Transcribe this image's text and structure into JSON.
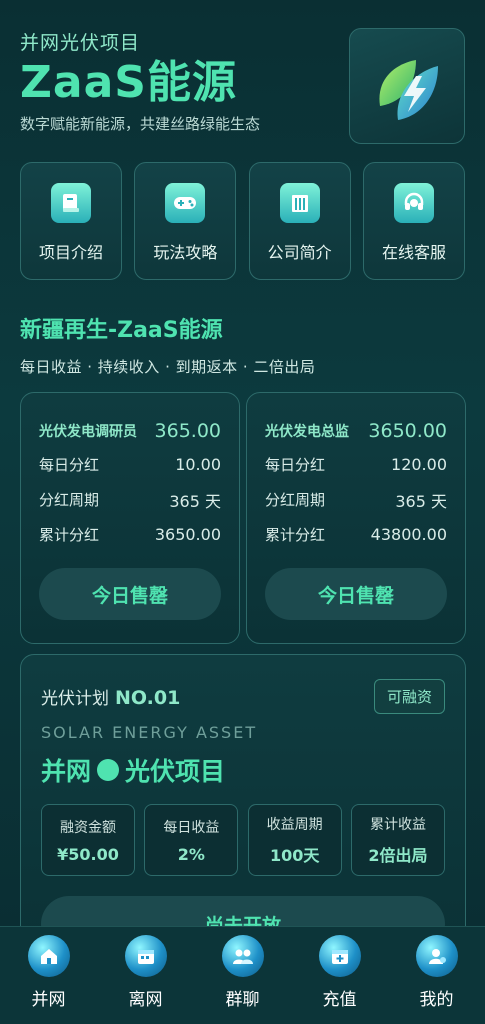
{
  "header": {
    "subtitle": "并网光伏项目",
    "brand": "ZaaS能源",
    "slogan": "数字赋能新能源，共建丝路绿能生态",
    "logo_icon": "leaf-lightning-logo"
  },
  "quick_nav": [
    {
      "label": "项目介绍",
      "icon": "book-icon"
    },
    {
      "label": "玩法攻略",
      "icon": "gamepad-icon"
    },
    {
      "label": "公司简介",
      "icon": "building-icon"
    },
    {
      "label": "在线客服",
      "icon": "headset-icon"
    }
  ],
  "section": {
    "title": "新疆再生-ZaaS能源",
    "tags": "每日收益 · 持续收入 · 到期返本 · 二倍出局"
  },
  "products": [
    {
      "name": "光伏发电调研员",
      "price": "365.00",
      "rows": [
        {
          "label": "每日分红",
          "value": "10.00"
        },
        {
          "label": "分红周期",
          "value": "365 天"
        },
        {
          "label": "累计分红",
          "value": "3650.00"
        }
      ],
      "button": "今日售罄"
    },
    {
      "name": "光伏发电总监",
      "price": "3650.00",
      "rows": [
        {
          "label": "每日分红",
          "value": "120.00"
        },
        {
          "label": "分红周期",
          "value": "365 天"
        },
        {
          "label": "累计分红",
          "value": "43800.00"
        }
      ],
      "button": "今日售罄"
    }
  ],
  "plan": {
    "prefix": "光伏计划",
    "number": "NO.01",
    "badge": "可融资",
    "english": "SOLAR ENERGY ASSET",
    "title_left": "并网",
    "title_right": "光伏项目",
    "stats": [
      {
        "label": "融资金额",
        "value": "¥50.00"
      },
      {
        "label": "每日收益",
        "value": "2%"
      },
      {
        "label": "收益周期",
        "value": "100天"
      },
      {
        "label": "累计收益",
        "value": "2倍出局"
      }
    ],
    "button": "尚未开放"
  },
  "tabbar": [
    {
      "label": "并网",
      "icon": "home-icon"
    },
    {
      "label": "离网",
      "icon": "calendar-icon"
    },
    {
      "label": "群聊",
      "icon": "group-chat-icon"
    },
    {
      "label": "充值",
      "icon": "recharge-icon"
    },
    {
      "label": "我的",
      "icon": "user-icon"
    }
  ],
  "colors": {
    "accent": "#4fe3b0",
    "background": "#0a2f33",
    "card_border": "#2d6a6a"
  }
}
